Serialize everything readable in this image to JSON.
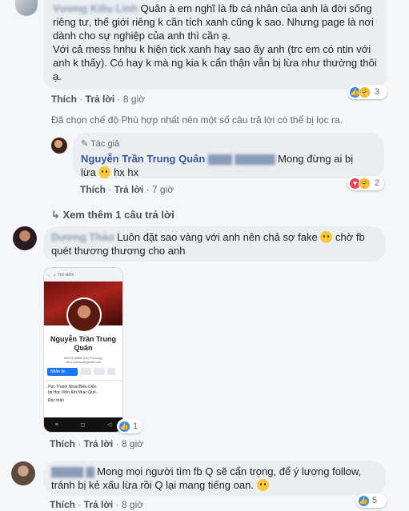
{
  "comments": [
    {
      "author_blurred": "Vương Kiều Linh",
      "text": "Quân à em nghĩ là fb cá nhân của anh là đời sống riêng tư, thế giới riêng k cần tích xanh cũng k sao. Nhưng page là nơi dành cho sự nghiệp của anh thì cần ạ.\nVới cả mess hnhu k hiện tick xanh hay sao ấy anh (trc em có ntin với anh k thấy). Có hay k mà ng kia k cẩn thận vẫn bị lừa như thường thôi ạ.",
      "actions": {
        "like": "Thích",
        "reply": "Trả lời",
        "time": "8 giờ"
      },
      "reaction_count": "3",
      "filter_notice": "Đã chọn chế độ Phù hợp nhất nên một số câu trả lời có thể bị lọc ra.",
      "reply": {
        "badge": "Tác giả",
        "author": "Nguyễn Trần Trung Quân",
        "mention_blurred": "▇▇▇ ▇▇▇▇▇",
        "text_1": "Mong đừng ai bị",
        "text_2": "lừa",
        "text_3": "hx hx",
        "actions": {
          "like": "Thích",
          "reply": "Trả lời",
          "time": "7 giờ"
        },
        "reaction_count": "2"
      },
      "see_more": "Xem thêm 1 câu trả lời"
    },
    {
      "author_blurred": "Dương Thảo",
      "text": "Luôn đặt sao vàng với anh nên chả sợ fake",
      "text_after_emoji": "chờ fb quét thương thương cho anh",
      "image": {
        "search": "Tìm kiếm",
        "profile_name": "Nguyễn Trần Trung Quân",
        "info_line": "0947516658 (Nhi Phương)",
        "email_line": "nthq.contact@gmail.com",
        "message_btn": "Nhắn tin",
        "edu_1": "Học Thanh Nhạc/Biểu Diễn",
        "edu_2": "tại Học Viện Âm Nhạc Quố...",
        "status": "Độc thân"
      },
      "reaction_count": "1",
      "actions": {
        "like": "Thích",
        "reply": "Trả lời",
        "time": "8 giờ"
      }
    },
    {
      "author_blurred": "▇▇▇▇ ▇",
      "text": "Mong mọi người tìm fb Q sẽ cẩn trọng, để ý lượng follow, tránh bị kẻ xấu lừa rồi Q lại mang tiếng oan.",
      "actions": {
        "like": "Thích",
        "reply": "Trả lời",
        "time": "8 giờ"
      },
      "reaction_count": "5"
    }
  ],
  "colors": {
    "link": "#385898",
    "bubble": "#ebedf0",
    "like": "#2d88ff",
    "love": "#f33e58",
    "care": "#f7b125"
  }
}
